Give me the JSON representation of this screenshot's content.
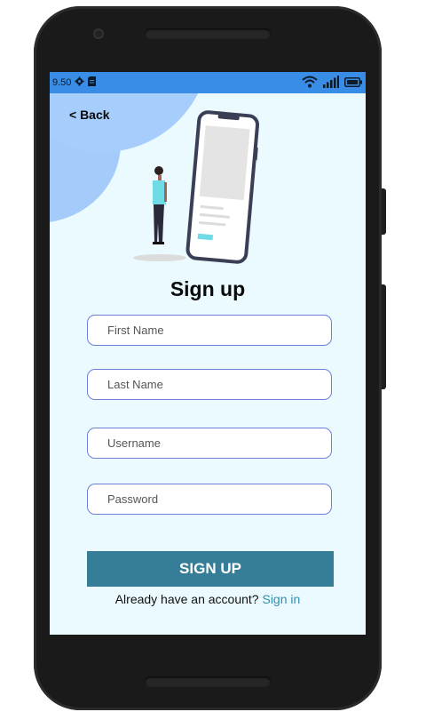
{
  "status": {
    "time": "9.50"
  },
  "nav": {
    "back_label": "< Back"
  },
  "page": {
    "title": "Sign up"
  },
  "form": {
    "first_name_placeholder": "First Name",
    "last_name_placeholder": "Last Name",
    "username_placeholder": "Username",
    "password_placeholder": "Password",
    "submit_label": "SIGN UP"
  },
  "footer": {
    "prompt": "Already have an account?",
    "link_label": "Sign in"
  },
  "colors": {
    "accent": "#367e98",
    "link": "#2f8fb0",
    "background": "#eafaff",
    "statusbar": "#3a8de6"
  }
}
